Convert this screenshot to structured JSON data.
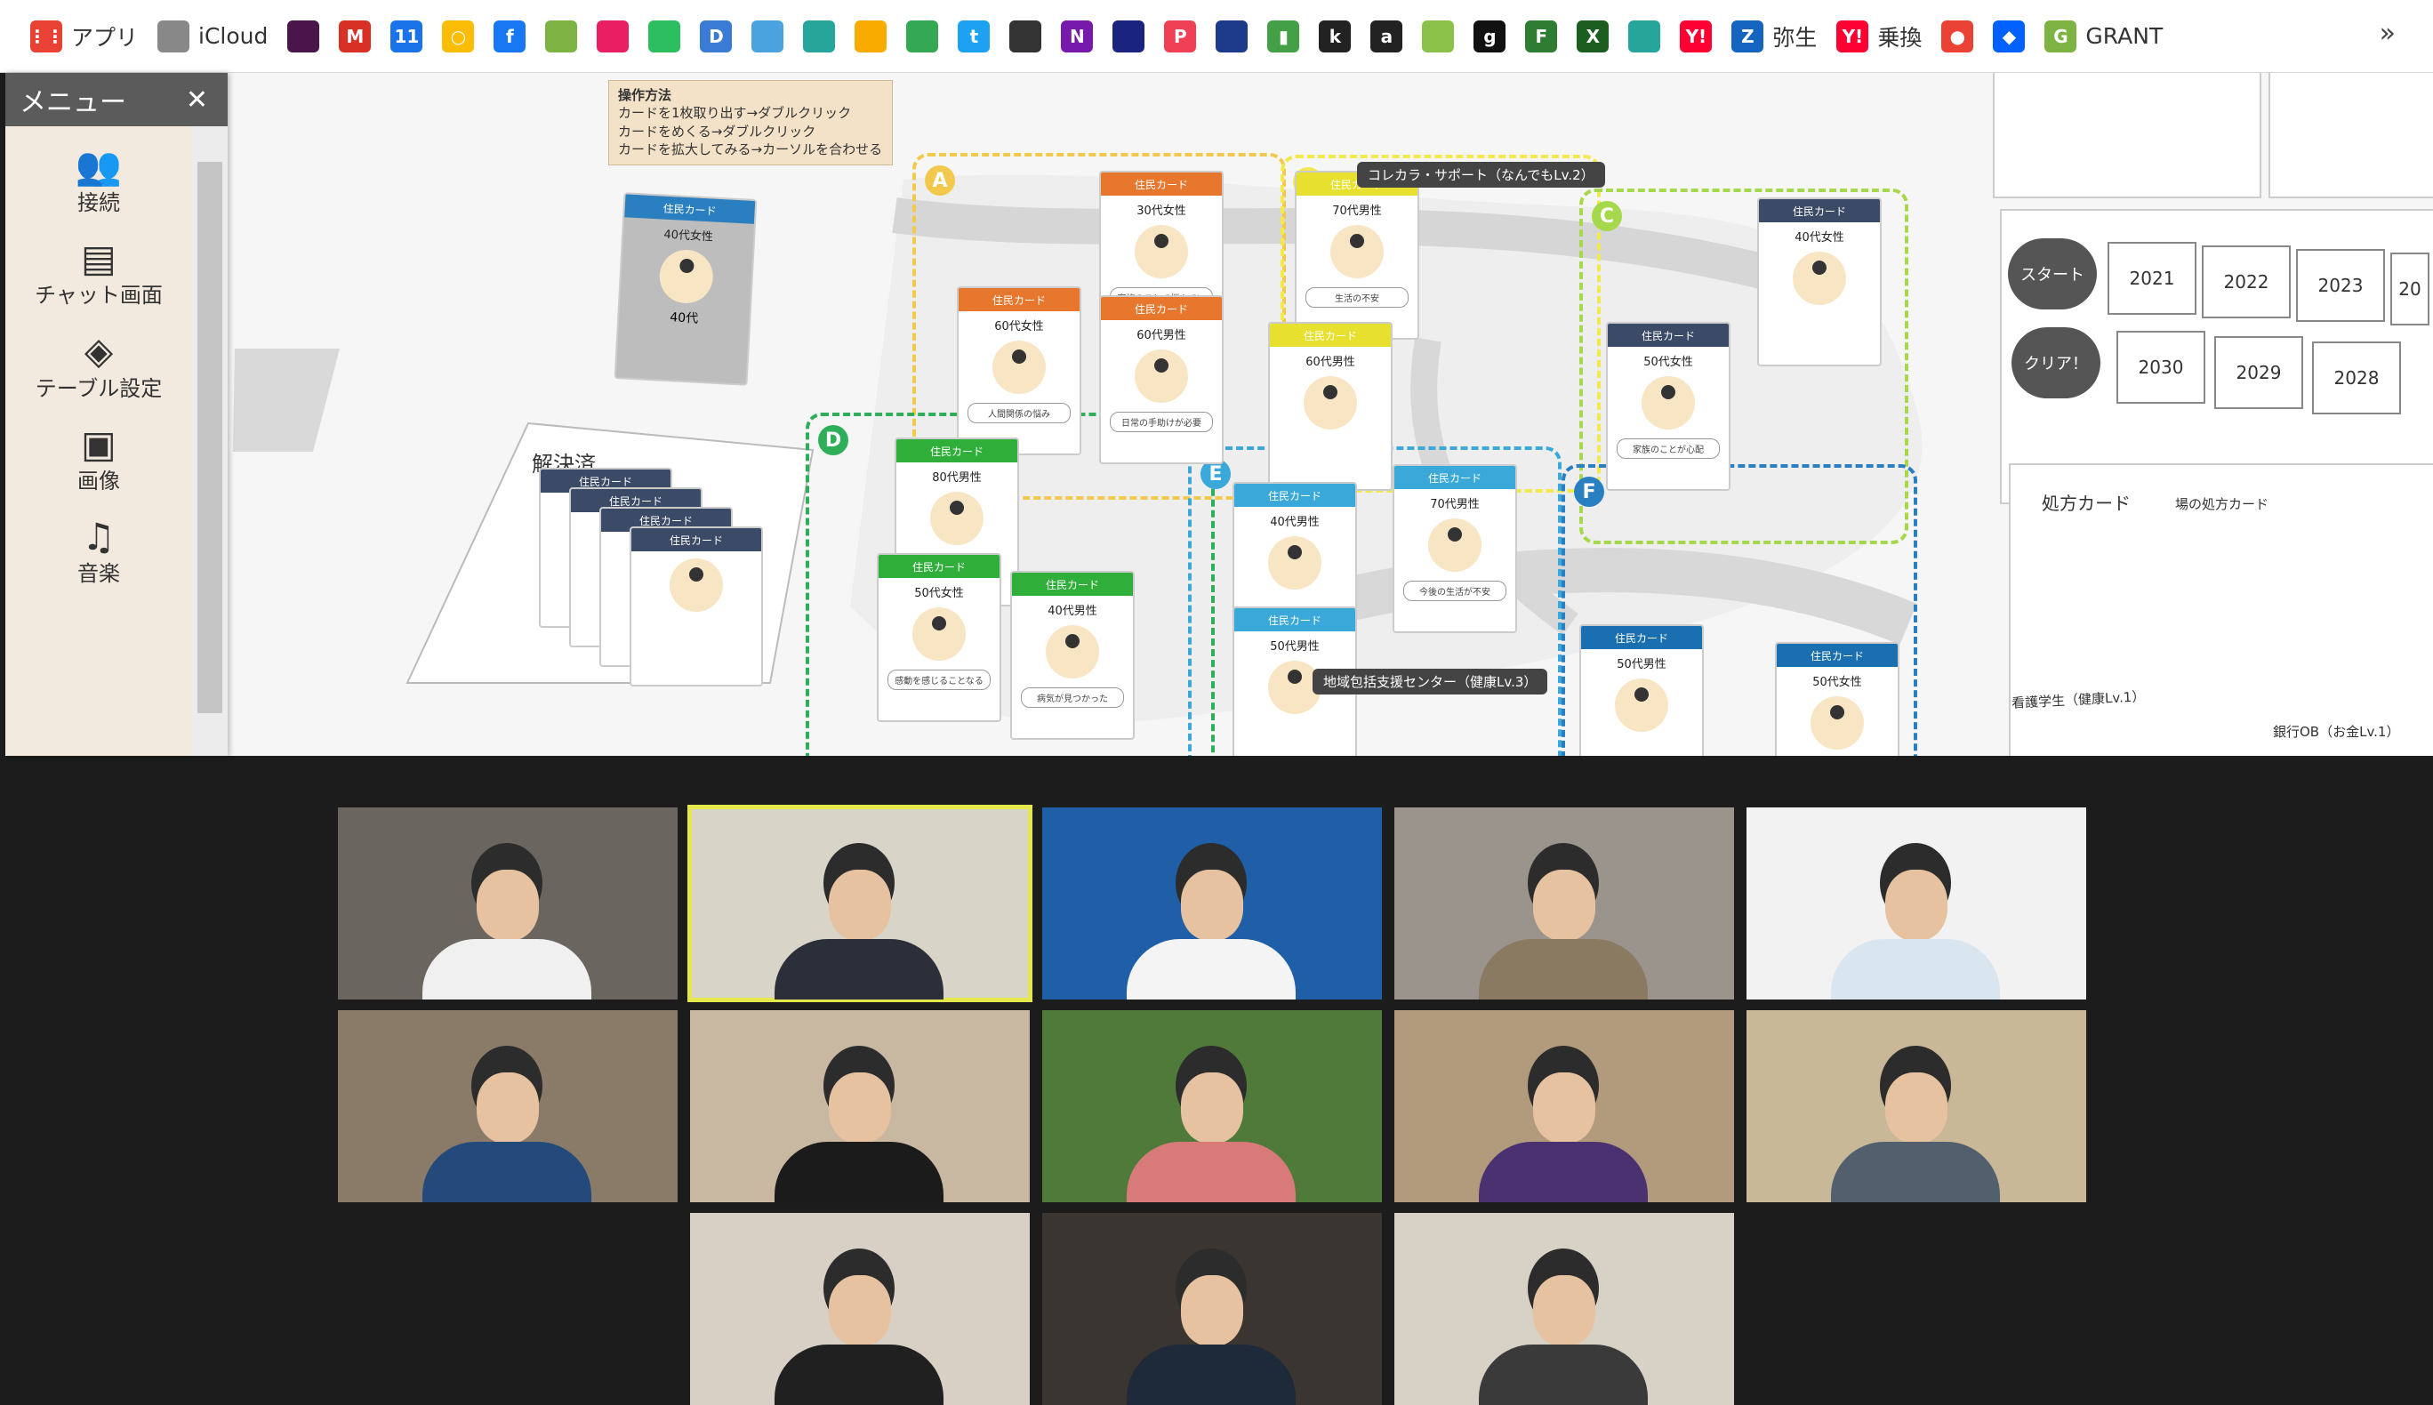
{
  "bookmarks": {
    "items": [
      {
        "label": "アプリ",
        "icon": "apps-grid-icon",
        "color": "#e94235"
      },
      {
        "label": "iCloud",
        "icon": "apple-icon",
        "color": "#888888"
      },
      {
        "label": "",
        "icon": "slack-icon",
        "color": "#4a154b"
      },
      {
        "label": "",
        "icon": "gmail-icon",
        "color": "#d93025"
      },
      {
        "label": "",
        "icon": "calendar-icon",
        "color": "#1a73e8"
      },
      {
        "label": "",
        "icon": "circle-icon",
        "color": "#fbbc04"
      },
      {
        "label": "",
        "icon": "facebook-icon",
        "color": "#1877f2"
      },
      {
        "label": "",
        "icon": "green-dot-icon",
        "color": "#7cb342"
      },
      {
        "label": "",
        "icon": "flower-icon",
        "color": "#e91e63"
      },
      {
        "label": "",
        "icon": "evernote-icon",
        "color": "#2dbe60"
      },
      {
        "label": "",
        "icon": "d-icon",
        "color": "#3a7bd5"
      },
      {
        "label": "",
        "icon": "urbolab-icon",
        "color": "#4aa3df"
      },
      {
        "label": "",
        "icon": "layers-icon",
        "color": "#26a69a"
      },
      {
        "label": "",
        "icon": "analytics-icon",
        "color": "#f9ab00"
      },
      {
        "label": "",
        "icon": "drive-icon",
        "color": "#34a853"
      },
      {
        "label": "",
        "icon": "twitter-icon",
        "color": "#1da1f2"
      },
      {
        "label": "",
        "icon": "pattern-icon",
        "color": "#333333"
      },
      {
        "label": "",
        "icon": "onenote-icon",
        "color": "#7719aa"
      },
      {
        "label": "",
        "icon": "nikkei-icon",
        "color": "#1a237e"
      },
      {
        "label": "",
        "icon": "pocket-icon",
        "color": "#ef4056"
      },
      {
        "label": "",
        "icon": "shield-icon",
        "color": "#1e3a8a"
      },
      {
        "label": "",
        "icon": "bar-chart-icon",
        "color": "#43a047"
      },
      {
        "label": "",
        "icon": "k-icon",
        "color": "#222222"
      },
      {
        "label": "",
        "icon": "amazon-icon",
        "color": "#222222"
      },
      {
        "label": "",
        "icon": "stack-icon",
        "color": "#8bc34a"
      },
      {
        "label": "",
        "icon": "g-icon",
        "color": "#111111"
      },
      {
        "label": "",
        "icon": "f-icon",
        "color": "#2e7d32"
      },
      {
        "label": "",
        "icon": "x-icon",
        "color": "#1b5e20"
      },
      {
        "label": "",
        "icon": "gear-green-icon",
        "color": "#26a69a"
      },
      {
        "label": "",
        "icon": "yahoo-icon",
        "color": "#ff0033"
      },
      {
        "label": "弥生",
        "icon": "yayoi-icon",
        "color": "#1565c0"
      },
      {
        "label": "乗換",
        "icon": "yahoo-icon",
        "color": "#ff0033"
      },
      {
        "label": "",
        "icon": "maps-pin-icon",
        "color": "#ea4335"
      },
      {
        "label": "",
        "icon": "dropbox-icon",
        "color": "#0061ff"
      },
      {
        "label": "GRANT",
        "icon": "grant-icon",
        "color": "#7cb342"
      }
    ],
    "more": "»"
  },
  "menu": {
    "title": "メニュー",
    "close": "✕",
    "items": [
      {
        "label": "接続",
        "icon": "people-icon"
      },
      {
        "label": "チャット画面",
        "icon": "chat-icon"
      },
      {
        "label": "テーブル設定",
        "icon": "layers-icon"
      },
      {
        "label": "画像",
        "icon": "image-icon"
      },
      {
        "label": "音楽",
        "icon": "music-icon"
      }
    ]
  },
  "board": {
    "howto_title": "操作方法",
    "howto_lines": [
      "カードを1枚取り出す→ダブルクリック",
      "カードをめくる→ダブルクリック",
      "カードを拡大してみる→カーソルを合わせる"
    ],
    "resolved_label": "解決済",
    "support_label": "コレカラ・サポート（なんでもLv.2）",
    "center_label": "地域包括支援センター（健康Lv.3）",
    "loose_card": {
      "header": "住民カード",
      "age": "40代女性",
      "label": "40代"
    },
    "zones": [
      {
        "id": "A",
        "color": "#f2c94c"
      },
      {
        "id": "B",
        "color": "#f2e94c"
      },
      {
        "id": "C",
        "color": "#a6d84c"
      },
      {
        "id": "D",
        "color": "#2fae5a"
      },
      {
        "id": "E",
        "color": "#3aa8d8"
      },
      {
        "id": "F",
        "color": "#2a7fc0"
      }
    ],
    "cards": [
      {
        "zone": "A",
        "header": "住民カード",
        "age": "30代女性",
        "desc": "家族のことで悩んでいる",
        "color": "#e8772e"
      },
      {
        "zone": "A",
        "header": "住民カード",
        "age": "60代女性",
        "desc": "人間関係の悩み",
        "color": "#e8772e"
      },
      {
        "zone": "A",
        "header": "住民カード",
        "age": "60代男性",
        "desc": "日常の手助けが必要",
        "color": "#e8772e"
      },
      {
        "zone": "B",
        "header": "住民カード",
        "age": "70代男性",
        "desc": "生活の不安",
        "color": "#e8e02e"
      },
      {
        "zone": "B",
        "header": "住民カード",
        "age": "60代男性",
        "desc": "",
        "color": "#e8e02e"
      },
      {
        "zone": "C",
        "header": "住民カード",
        "age": "40代女性",
        "desc": "",
        "color": "#3b4a66"
      },
      {
        "zone": "C",
        "header": "住民カード",
        "age": "50代女性",
        "desc": "家族のことが心配",
        "color": "#3b4a66"
      },
      {
        "zone": "D",
        "header": "住民カード",
        "age": "80代男性",
        "desc": "",
        "color": "#2fae3a"
      },
      {
        "zone": "D",
        "header": "住民カード",
        "age": "50代女性",
        "desc": "感動を感じることなる",
        "color": "#2fae3a"
      },
      {
        "zone": "D",
        "header": "住民カード",
        "age": "40代男性",
        "desc": "病気が見つかった",
        "color": "#2fae3a"
      },
      {
        "zone": "E",
        "header": "住民カード",
        "age": "40代男性",
        "desc": "",
        "color": "#3aa8d8"
      },
      {
        "zone": "E",
        "header": "住民カード",
        "age": "70代男性",
        "desc": "今後の生活が不安",
        "color": "#3aa8d8"
      },
      {
        "zone": "E",
        "header": "住民カード",
        "age": "50代男性",
        "desc": "",
        "color": "#3aa8d8"
      },
      {
        "zone": "F",
        "header": "住民カード",
        "age": "50代男性",
        "desc": "",
        "color": "#1a6fb0"
      },
      {
        "zone": "F",
        "header": "住民カード",
        "age": "50代女性",
        "desc": "",
        "color": "#1a6fb0"
      }
    ],
    "timeline": {
      "start": "スタート",
      "clear": "クリア！",
      "years_top": [
        "2021",
        "2022",
        "2023",
        "20"
      ],
      "years_bottom": [
        "2030",
        "2029",
        "2028"
      ]
    },
    "prescription": {
      "title": "処方カード",
      "subtitle": "場の処方カード"
    },
    "care_label": "看護学生（健康Lv.1）",
    "bank_label": "銀行OB（お金Lv.1）"
  },
  "video": {
    "tiles": [
      {
        "name": "participant-1",
        "bg": "#6b6560",
        "shirt": "#f0f0f0"
      },
      {
        "name": "participant-2",
        "bg": "#d9d4c8",
        "shirt": "#2b2f3a",
        "active": true
      },
      {
        "name": "participant-3",
        "bg": "#1f5fa8",
        "shirt": "#f4f4f4"
      },
      {
        "name": "participant-4",
        "bg": "#9a948c",
        "shirt": "#8a7a62"
      },
      {
        "name": "participant-5",
        "bg": "#f2f2f2",
        "shirt": "#d9e6f0"
      },
      {
        "name": "participant-6",
        "bg": "#8a7a68",
        "shirt": "#234a7a"
      },
      {
        "name": "participant-7",
        "bg": "#c8b8a2",
        "shirt": "#1b1b1b"
      },
      {
        "name": "participant-8",
        "bg": "#4f7a3a",
        "shirt": "#d97a7a"
      },
      {
        "name": "participant-9",
        "bg": "#b29a7c",
        "shirt": "#4a3270"
      },
      {
        "name": "participant-10",
        "bg": "#c9b898",
        "shirt": "#52606e"
      },
      {
        "name": "participant-11",
        "bg": "#d8d0c4",
        "shirt": "#202020"
      },
      {
        "name": "participant-12",
        "bg": "#3a3530",
        "shirt": "#1e2a3a"
      },
      {
        "name": "participant-13",
        "bg": "#d8d2c6",
        "shirt": "#3a3a3a"
      }
    ]
  }
}
